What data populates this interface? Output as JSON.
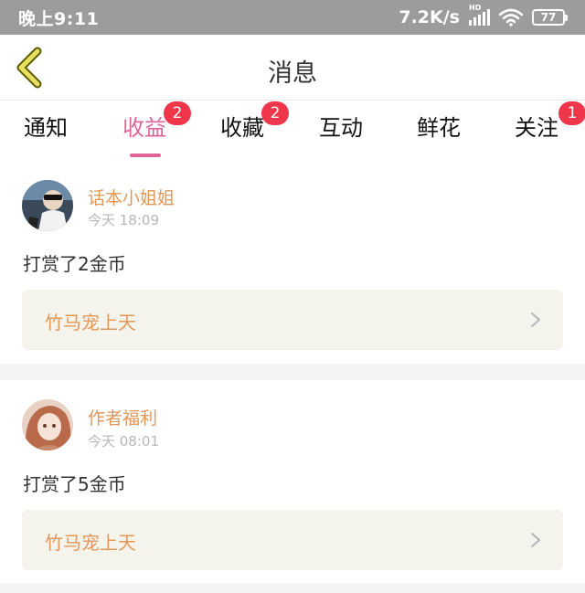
{
  "status_bar": {
    "time": "晚上9:11",
    "net_speed": "7.2K/s",
    "hd_label": "HD",
    "battery": "77"
  },
  "header": {
    "title": "消息",
    "back_icon": "chevron-left-icon"
  },
  "tabs": [
    {
      "label": "通知",
      "badge": null,
      "active": false
    },
    {
      "label": "收益",
      "badge": "2",
      "active": true
    },
    {
      "label": "收藏",
      "badge": "2",
      "active": false
    },
    {
      "label": "互动",
      "badge": null,
      "active": false
    },
    {
      "label": "鲜花",
      "badge": null,
      "active": false
    },
    {
      "label": "关注",
      "badge": "1",
      "active": false
    }
  ],
  "messages": [
    {
      "username": "话本小姐姐",
      "time": "今天 18:09",
      "text": "打赏了2金币",
      "book_title": "竹马宠上天"
    },
    {
      "username": "作者福利",
      "time": "今天 08:01",
      "text": "打赏了5金币",
      "book_title": "竹马宠上天"
    }
  ],
  "colors": {
    "accent_pink": "#e0629a",
    "badge_red": "#f0364a",
    "name_orange": "#e0975a",
    "back_icon_yellow": "#e8d84a"
  }
}
